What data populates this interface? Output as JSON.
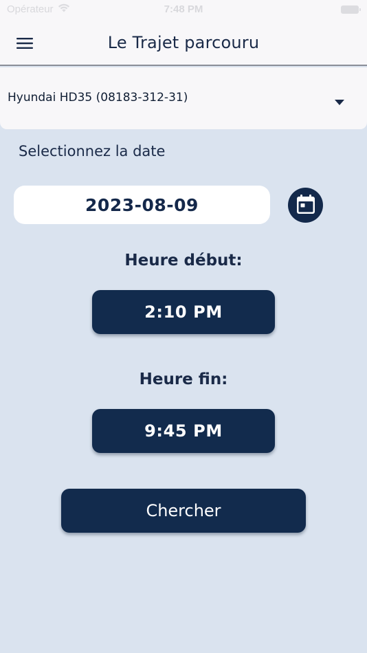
{
  "status_bar": {
    "carrier": "Opérateur",
    "time": "7:48 PM"
  },
  "header": {
    "title": "Le Trajet parcouru"
  },
  "vehicle": {
    "selected": "Hyundai HD35 (08183-312-31)"
  },
  "date_section": {
    "label": "Selectionnez la date",
    "value": "2023-08-09"
  },
  "start_time": {
    "label": "Heure début:",
    "value": "2:10 PM"
  },
  "end_time": {
    "label": "Heure fin:",
    "value": "9:45 PM"
  },
  "search": {
    "label": "Chercher"
  },
  "icons": {
    "menu": "hamburger-menu-icon",
    "dropdown": "caret-down-icon",
    "calendar": "calendar-icon",
    "wifi": "wifi-icon",
    "battery": "battery-icon"
  },
  "colors": {
    "background": "#dae3ef",
    "surface": "#f8f7f9",
    "primary": "#122b4d",
    "text": "#14284a"
  }
}
